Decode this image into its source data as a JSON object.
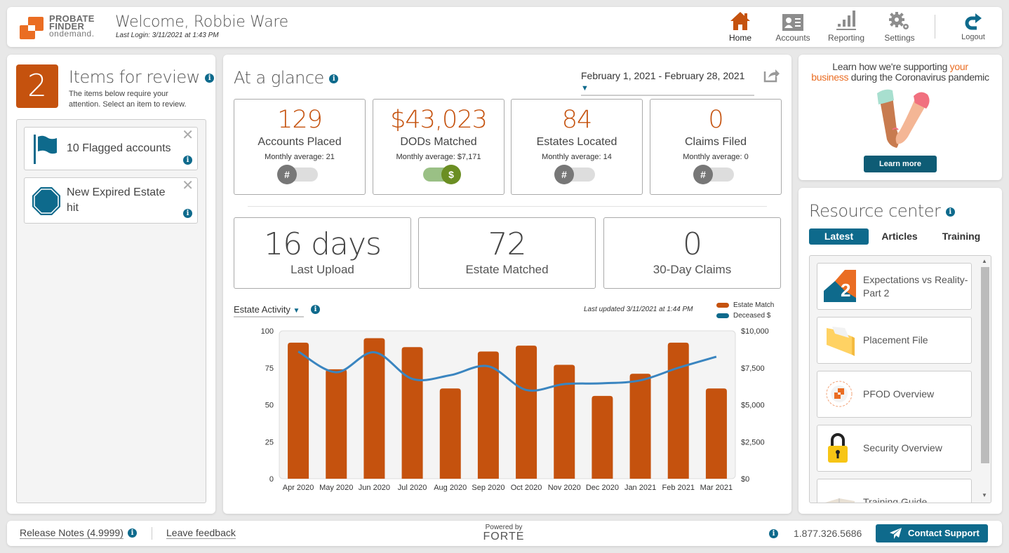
{
  "header": {
    "logo": {
      "line1": "PROBATE",
      "line2": "FINDER",
      "line3": "ondemand."
    },
    "welcome": "Welcome, Robbie Ware",
    "last_login": "Last Login: 3/11/2021 at 1:43 PM",
    "nav": [
      {
        "label": "Home",
        "icon": "home-icon",
        "active": true
      },
      {
        "label": "Accounts",
        "icon": "id-card-icon"
      },
      {
        "label": "Reporting",
        "icon": "bar-chart-icon"
      },
      {
        "label": "Settings",
        "icon": "gear-icon"
      },
      {
        "label": "Logout",
        "icon": "logout-icon"
      }
    ]
  },
  "review": {
    "count": "2",
    "title": "Items for review",
    "subtitle": "The items below require your attention. Select an item to review.",
    "items": [
      {
        "label": "10 Flagged accounts",
        "icon": "flag-icon"
      },
      {
        "label": "New Expired Estate hit",
        "icon": "stop-octagon-icon"
      }
    ]
  },
  "glance": {
    "title": "At a glance",
    "date_range": "February 1, 2021 - February 28, 2021",
    "stats": [
      {
        "value": "129",
        "name": "Accounts Placed",
        "avg": "Monthly average: 21",
        "toggle": "#",
        "toggle_on": false
      },
      {
        "value": "$43,023",
        "name": "DODs Matched",
        "avg": "Monthly average: $7,171",
        "toggle": "$",
        "toggle_on": true
      },
      {
        "value": "84",
        "name": "Estates Located",
        "avg": "Monthly average: 14",
        "toggle": "#",
        "toggle_on": false
      },
      {
        "value": "0",
        "name": "Claims Filed",
        "avg": "Monthly average: 0",
        "toggle": "#",
        "toggle_on": false
      }
    ],
    "stats2": [
      {
        "value": "16 days",
        "name": "Last Upload"
      },
      {
        "value": "72",
        "name": "Estate Matched"
      },
      {
        "value": "0",
        "name": "30-Day Claims"
      }
    ],
    "chart_select": "Estate Activity",
    "last_updated": "Last updated 3/11/2021 at 1:44 PM"
  },
  "chart_data": {
    "type": "bar",
    "title": "Estate Activity",
    "categories": [
      "Apr 2020",
      "May 2020",
      "Jun 2020",
      "Jul 2020",
      "Aug 2020",
      "Sep 2020",
      "Oct 2020",
      "Nov 2020",
      "Dec 2020",
      "Jan 2021",
      "Feb 2021",
      "Mar 2021"
    ],
    "series": [
      {
        "name": "Estate Match",
        "type": "bar",
        "axis": "left",
        "color": "#c5520e",
        "values": [
          92,
          74,
          95,
          89,
          61,
          86,
          90,
          77,
          56,
          71,
          92,
          61
        ]
      },
      {
        "name": "Deceased $",
        "type": "line",
        "axis": "right",
        "color": "#3a85c0",
        "values": [
          8600,
          7200,
          8550,
          6750,
          7000,
          7600,
          6000,
          6400,
          6450,
          6650,
          7500,
          8250
        ]
      }
    ],
    "ylim_left": [
      0,
      100
    ],
    "yticks_left": [
      "0",
      "25",
      "50",
      "75",
      "100"
    ],
    "ylim_right": [
      0,
      10000
    ],
    "yticks_right": [
      "$0",
      "$2,500",
      "$5,000",
      "$7,500",
      "$10,000"
    ],
    "legend": "top-right",
    "grid": false
  },
  "promo": {
    "text_before": "Learn how we're supporting ",
    "highlight1": "your",
    "highlight2": "business",
    "text_after": " during the Coronavirus pandemic",
    "button": "Learn more"
  },
  "resources": {
    "title": "Resource center",
    "tabs": [
      {
        "label": "Latest",
        "active": true
      },
      {
        "label": "Articles"
      },
      {
        "label": "Training"
      }
    ],
    "items": [
      {
        "label": "Expectations vs Reality- Part 2",
        "icon": "number-2-icon"
      },
      {
        "label": "Placement File",
        "icon": "folder-icon"
      },
      {
        "label": "PFOD Overview",
        "icon": "pfod-logo-icon"
      },
      {
        "label": "Security Overview",
        "icon": "padlock-icon"
      },
      {
        "label": "Training Guide",
        "icon": "book-icon"
      }
    ]
  },
  "footer": {
    "release_notes": "Release Notes (4.9999)",
    "feedback": "Leave feedback",
    "powered_by": "Powered by",
    "brand": "FORTE",
    "phone": "1.877.326.5686",
    "contact": "Contact Support"
  },
  "colors": {
    "accent": "#c5520e",
    "primary": "#0e6a8c",
    "line": "#3a85c0",
    "toggle_on": "#6b8e23"
  }
}
